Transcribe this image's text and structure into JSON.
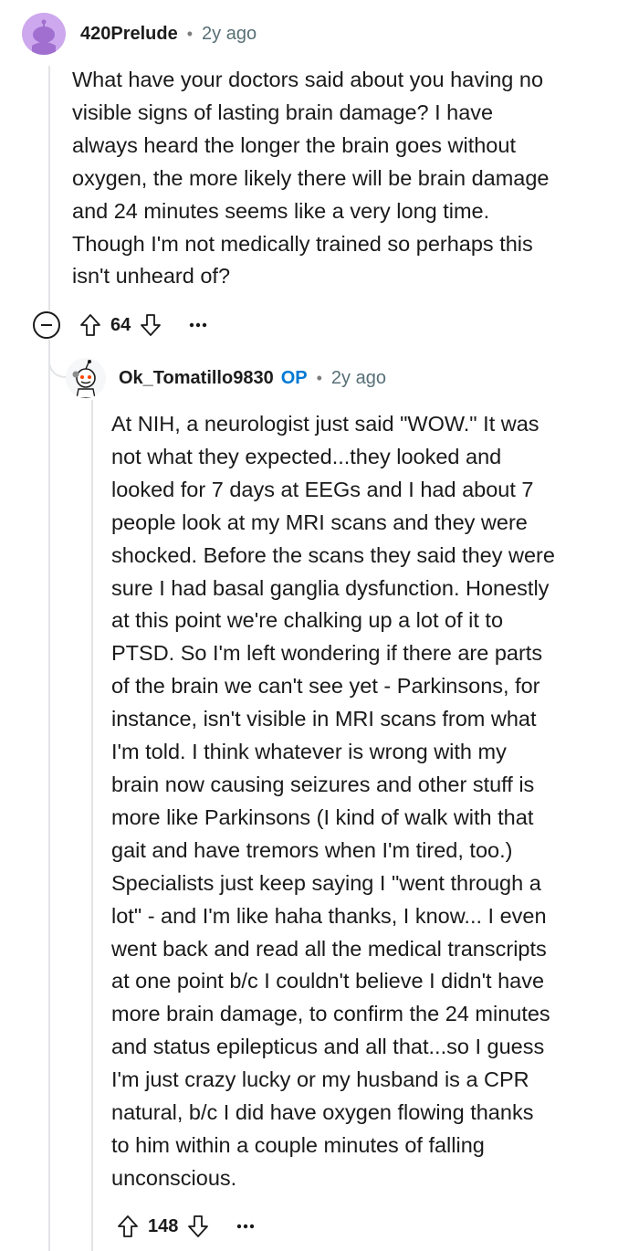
{
  "comments": [
    {
      "username": "420Prelude",
      "separator": "•",
      "time": "2y ago",
      "body_lines": [
        "What have your doctors said about you having no",
        "visible signs of lasting brain damage? I have",
        "always heard the longer the brain goes without",
        "oxygen, the more likely there will be brain damage",
        "and 24 minutes seems like a very long time.",
        "Though I'm not medically trained so perhaps this",
        "isn't unheard of?"
      ],
      "votes": "64",
      "more": "•••"
    },
    {
      "username": "Ok_Tomatillo9830",
      "badge": "OP",
      "separator": "•",
      "time": "2y ago",
      "body_lines": [
        "At NIH, a neurologist just said \"WOW.\" It was",
        "not what they expected...they looked and",
        "looked for 7 days at EEGs and I had about 7",
        "people look at my MRI scans and they were",
        "shocked. Before the scans they said they were",
        "sure I had basal ganglia dysfunction. Honestly",
        "at this point we're chalking up a lot of it to",
        "PTSD. So I'm left wondering if there are parts",
        "of the brain we can't see yet - Parkinsons, for",
        "instance, isn't visible in MRI scans from what",
        "I'm told. I think whatever is wrong with my",
        "brain now causing seizures and other stuff is",
        "more like Parkinsons (I kind of walk with that",
        "gait and have tremors when I'm tired, too.)",
        "Specialists just keep saying I \"went through a",
        "lot\" - and I'm like haha thanks, I know... I even",
        "went back and read all the medical transcripts",
        "at one point b/c I couldn't believe I didn't have",
        "more brain damage, to confirm the 24 minutes",
        "and status epilepticus and all that...so I guess",
        "I'm just crazy lucky or my husband is a CPR",
        "natural, b/c I did have oxygen flowing thanks",
        "to him within a couple minutes of falling",
        "unconscious."
      ],
      "votes": "148",
      "more": "•••"
    }
  ],
  "icons": {
    "avatar_1": "snoo-avatar-icon",
    "avatar_2": "snoo-avatar-icon",
    "collapse": "collapse-minus-icon",
    "upvote": "upvote-arrow-icon",
    "downvote": "downvote-arrow-icon",
    "more": "more-options-icon"
  },
  "colors": {
    "op_badge": "#0079d3",
    "avatar_1_bg": "#cda8ee",
    "thread_line": "#e2e4e6",
    "meta_text": "#576f76"
  }
}
